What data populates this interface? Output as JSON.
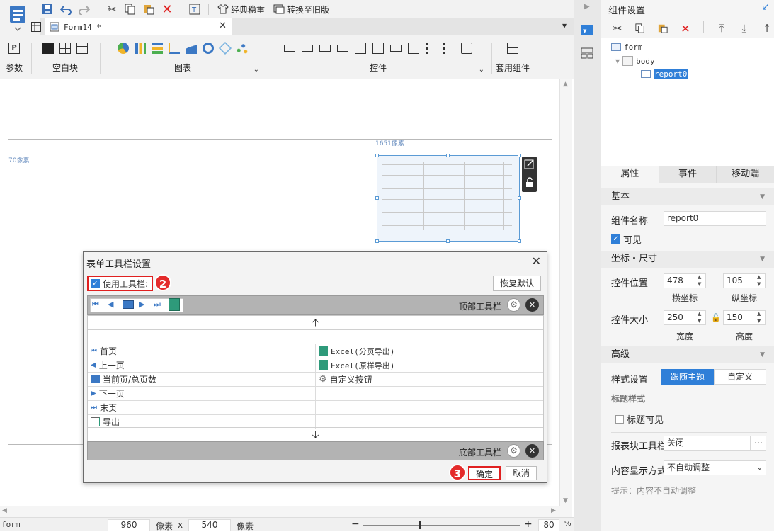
{
  "toolbar": {
    "classic_label": "经典稳重",
    "switch_label": "转换至旧版"
  },
  "document_tab": {
    "label": "Form14 *"
  },
  "ribbon": {
    "groups": [
      {
        "label": "参数"
      },
      {
        "label": "空白块"
      },
      {
        "label": "图表"
      },
      {
        "label": "控件"
      },
      {
        "label": "套用组件"
      }
    ]
  },
  "canvas": {
    "width_hint": "1651像素",
    "height_hint": "70像素"
  },
  "status": {
    "left_label": "form",
    "width_value": "960",
    "unit_label": "像素",
    "times": "x",
    "height_value": "540",
    "unit_label2": "像素",
    "zoom_value": "80",
    "percent": "%"
  },
  "panel": {
    "title": "组件设置",
    "tree": {
      "root": "form",
      "body": "body",
      "report": "report0"
    },
    "tabs": [
      "属性",
      "事件",
      "移动端"
    ],
    "basic": {
      "header": "基本",
      "name_label": "组件名称",
      "name_value": "report0",
      "visible_label": "可见"
    },
    "coords": {
      "header": "坐标・尺寸",
      "position_label": "控件位置",
      "x_value": "478",
      "y_value": "105",
      "x_label": "横坐标",
      "y_label": "纵坐标",
      "size_label": "控件大小",
      "w_value": "250",
      "h_value": "150",
      "w_label": "宽度",
      "h_label": "高度"
    },
    "advanced": {
      "header": "高级",
      "style_label": "样式设置",
      "style_follow": "跟随主题",
      "style_custom": "自定义",
      "title_style_label": "标题样式",
      "title_visible_label": "标题可见",
      "toolbar_label": "报表块工具栏",
      "toolbar_value": "关闭",
      "display_label": "内容显示方式",
      "display_value": "不自动调整",
      "hint": "提示：内容不自动调整"
    }
  },
  "dialog": {
    "title": "表单工具栏设置",
    "use_toolbar_label": "使用工具栏:",
    "restore_label": "恢复默认",
    "top_bar_label": "顶部工具栏",
    "bottom_bar_label": "底部工具栏",
    "left_items": [
      "首页",
      "上一页",
      "当前页/总页数",
      "下一页",
      "末页",
      "导出"
    ],
    "right_items": [
      "Excel(分页导出)",
      "Excel(原样导出)",
      "自定义按钮"
    ],
    "ok_label": "确定",
    "cancel_label": "取消",
    "badge_2": "2",
    "badge_3": "3"
  },
  "colors": {
    "accent": "#2f7fd8",
    "annotation_red": "#e02020",
    "selection": "#5b9bd5"
  }
}
